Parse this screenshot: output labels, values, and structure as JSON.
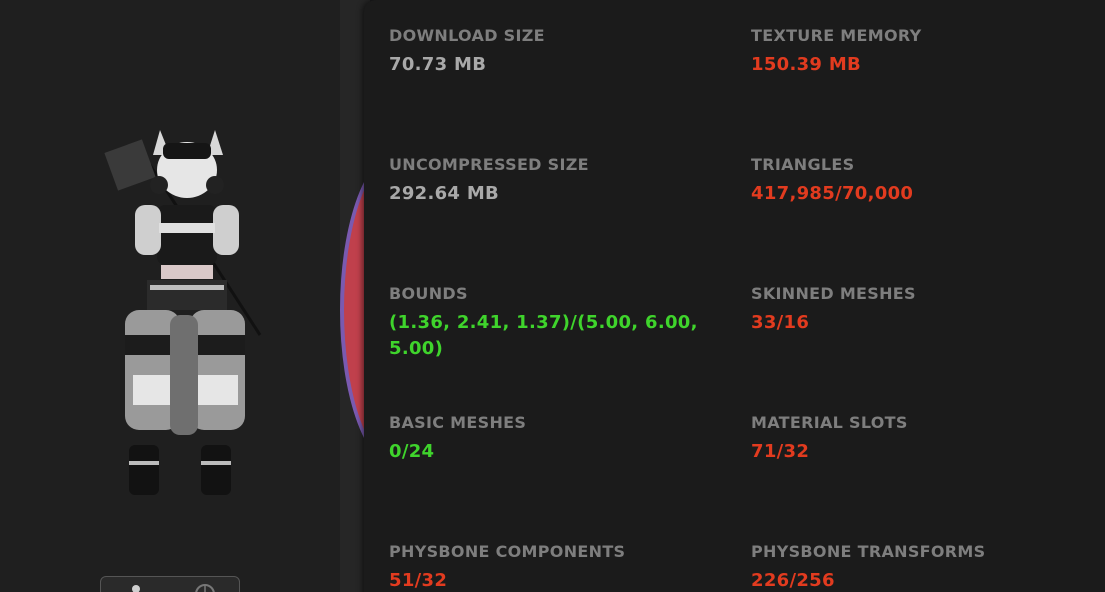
{
  "colors": {
    "neutral": "#a9a9a9",
    "over_limit": "#e23b1f",
    "ok": "#3fd42c",
    "label": "#7e7e7e"
  },
  "preview": {
    "toggle_icons": [
      "avatar-view-icon",
      "sphere-view-icon"
    ]
  },
  "stats": {
    "download_size": {
      "label": "DOWNLOAD SIZE",
      "value": "70.73 MB",
      "status": "neutral"
    },
    "texture_memory": {
      "label": "TEXTURE MEMORY",
      "value": "150.39 MB",
      "status": "over_limit"
    },
    "uncompressed_size": {
      "label": "UNCOMPRESSED SIZE",
      "value": "292.64 MB",
      "status": "neutral"
    },
    "triangles": {
      "label": "TRIANGLES",
      "value": "417,985/70,000",
      "status": "over_limit"
    },
    "bounds": {
      "label": "BOUNDS",
      "value_line1": "(1.36, 2.41, 1.37)/(5.00, 6.00,",
      "value_line2": "5.00)",
      "status": "ok"
    },
    "skinned_meshes": {
      "label": "SKINNED MESHES",
      "value": "33/16",
      "status": "over_limit"
    },
    "basic_meshes": {
      "label": "BASIC MESHES",
      "value": "0/24",
      "status": "ok"
    },
    "material_slots": {
      "label": "MATERIAL SLOTS",
      "value": "71/32",
      "status": "over_limit"
    },
    "physbone_components": {
      "label": "PHYSBONE COMPONENTS",
      "value": "51/32",
      "status": "over_limit"
    },
    "physbone_transforms": {
      "label": "PHYSBONE TRANSFORMS",
      "value": "226/256",
      "status": "over_limit"
    }
  }
}
